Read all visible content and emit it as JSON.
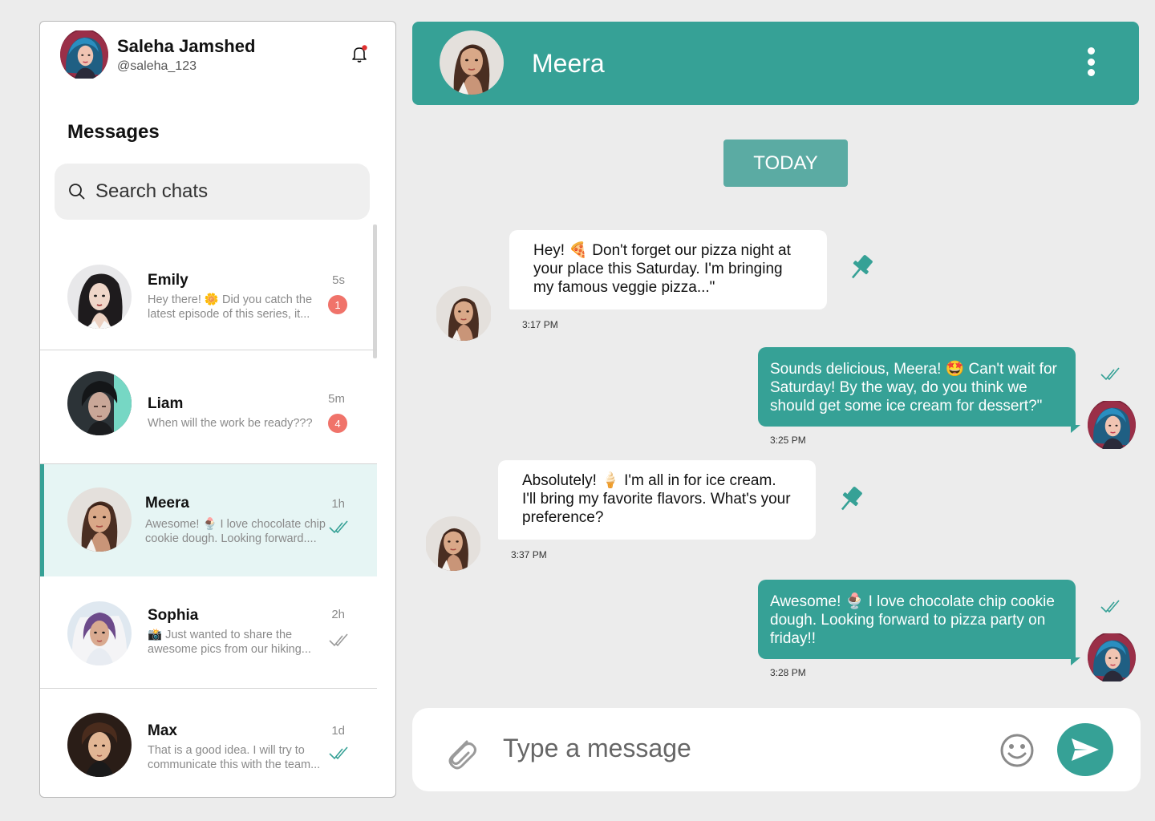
{
  "user": {
    "name": "Saleha Jamshed",
    "handle": "@saleha_123"
  },
  "sidebar": {
    "title": "Messages",
    "search_placeholder": "Search chats",
    "chats": [
      {
        "name": "Emily",
        "preview": "Hey there! 🌼 Did you catch the latest episode of this series, it...",
        "time": "5s",
        "unread": "1"
      },
      {
        "name": "Liam",
        "preview": "When will the work be ready???",
        "time": "5m",
        "unread": "4"
      },
      {
        "name": "Meera",
        "preview": "Awesome! 🍨 I love chocolate chip cookie dough. Looking forward....",
        "time": "1h",
        "status": "read"
      },
      {
        "name": "Sophia",
        "preview": "📸 Just wanted to share the awesome pics from our hiking...",
        "time": "2h",
        "status": "delivered"
      },
      {
        "name": "Max",
        "preview": "That is a good idea. I will try to communicate this with the team...",
        "time": "1d",
        "status": "read"
      }
    ]
  },
  "conversation": {
    "contact_name": "Meera",
    "date_label": "TODAY",
    "messages": [
      {
        "from": "Meera",
        "direction": "in",
        "text": "Hey! 🍕 Don't forget our pizza night at your place this Saturday. I'm bringing my famous veggie pizza...\"",
        "time": "3:17 PM",
        "pinned": true
      },
      {
        "from": "Saleha Jamshed",
        "direction": "out",
        "text": "Sounds delicious, Meera! 🤩 Can't wait for Saturday! By the way, do you think we should get some ice cream for dessert?\"",
        "time": "3:25 PM",
        "status": "read"
      },
      {
        "from": "Meera",
        "direction": "in",
        "text": "Absolutely! 🍦 I'm all in for ice cream. I'll bring my favorite flavors. What's your preference?",
        "time": "3:37 PM",
        "pinned": true
      },
      {
        "from": "Saleha Jamshed",
        "direction": "out",
        "text": "Awesome! 🍨 I love chocolate chip cookie dough. Looking forward to pizza party on friday!!",
        "time": "3:28 PM",
        "status": "read"
      }
    ]
  },
  "composer": {
    "placeholder": "Type a message"
  },
  "colors": {
    "accent": "#36a196",
    "badge": "#f0736a",
    "active_row": "#e6f5f4",
    "date_chip": "#5baba3"
  },
  "icons": [
    "bell-icon",
    "search-icon",
    "kebab-menu-icon",
    "pin-icon",
    "double-check-icon",
    "paperclip-icon",
    "smiley-icon",
    "send-icon"
  ]
}
